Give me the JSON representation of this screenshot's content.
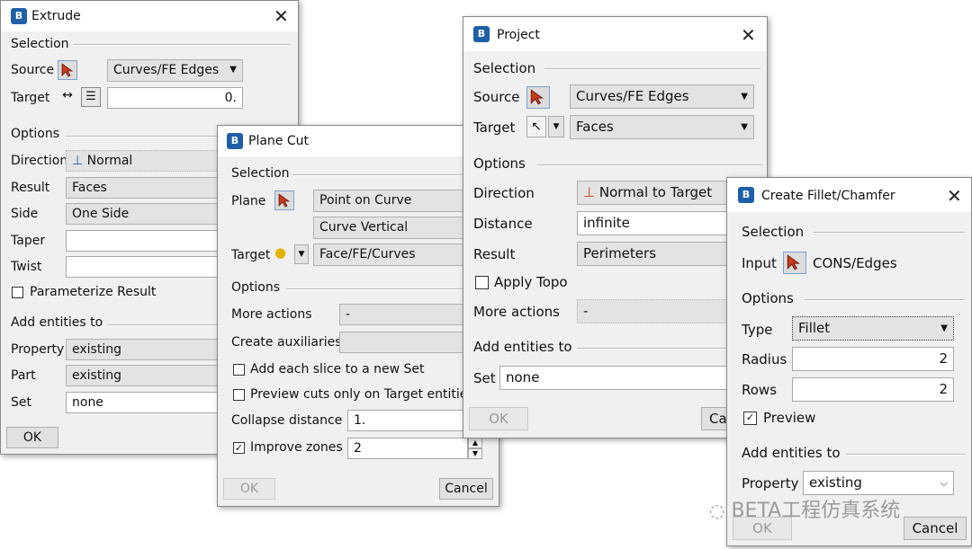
{
  "extrude": {
    "title": "Extrude",
    "selection": "Selection",
    "source_label": "Source",
    "source_value": "Curves/FE Edges",
    "target_label": "Target",
    "target_value": "0.",
    "options": "Options",
    "direction_label": "Direction",
    "direction_value": "Normal",
    "result_label": "Result",
    "result_value": "Faces",
    "side_label": "Side",
    "side_value": "One Side",
    "taper_label": "Taper",
    "twist_label": "Twist",
    "parameterize_label": "Parameterize Result",
    "add_entities": "Add entities to",
    "property_label": "Property",
    "property_value": "existing",
    "part_label": "Part",
    "part_value": "existing",
    "set_label": "Set",
    "set_value": "none",
    "ok": "OK"
  },
  "plane_cut": {
    "title": "Plane Cut",
    "selection": "Selection",
    "plane_label": "Plane",
    "plane_value1": "Point on Curve",
    "plane_value2": "Curve Vertical",
    "target_label": "Target",
    "target_value": "Face/FE/Curves",
    "options": "Options",
    "more_actions_label": "More actions",
    "more_actions_value": "-",
    "create_aux_label": "Create auxiliaries",
    "add_slice_label": "Add each slice to a new Set",
    "preview_cuts_label": "Preview cuts only on Target entities",
    "collapse_label": "Collapse distance",
    "collapse_value": "1.",
    "improve_label": "Improve zones",
    "improve_value": "2",
    "ok": "OK",
    "cancel": "Cancel"
  },
  "project": {
    "title": "Project",
    "selection": "Selection",
    "source_label": "Source",
    "source_value": "Curves/FE Edges",
    "target_label": "Target",
    "target_value": "Faces",
    "options": "Options",
    "direction_label": "Direction",
    "direction_value": "Normal to Target",
    "distance_label": "Distance",
    "distance_value": "infinite",
    "result_label": "Result",
    "result_value": "Perimeters",
    "apply_topo_label": "Apply Topo",
    "more_actions_label": "More actions",
    "more_actions_value": "-",
    "add_entities": "Add entities to",
    "set_label": "Set",
    "set_value": "none",
    "ok": "OK",
    "cancel_partial": "Ca"
  },
  "fillet": {
    "title": "Create Fillet/Chamfer",
    "selection": "Selection",
    "input_label": "Input",
    "input_value": "CONS/Edges",
    "options": "Options",
    "type_label": "Type",
    "type_value": "Fillet",
    "radius_label": "Radius",
    "radius_value": "2",
    "rows_label": "Rows",
    "rows_value": "2",
    "preview_label": "Preview",
    "add_entities": "Add entities to",
    "property_label": "Property",
    "property_value": "existing",
    "ok": "OK",
    "cancel": "Cancel"
  },
  "watermark": "BETA工程仿真系统",
  "colors": {
    "accent": "#1f5fa8",
    "pick_red": "#c83a1e"
  }
}
